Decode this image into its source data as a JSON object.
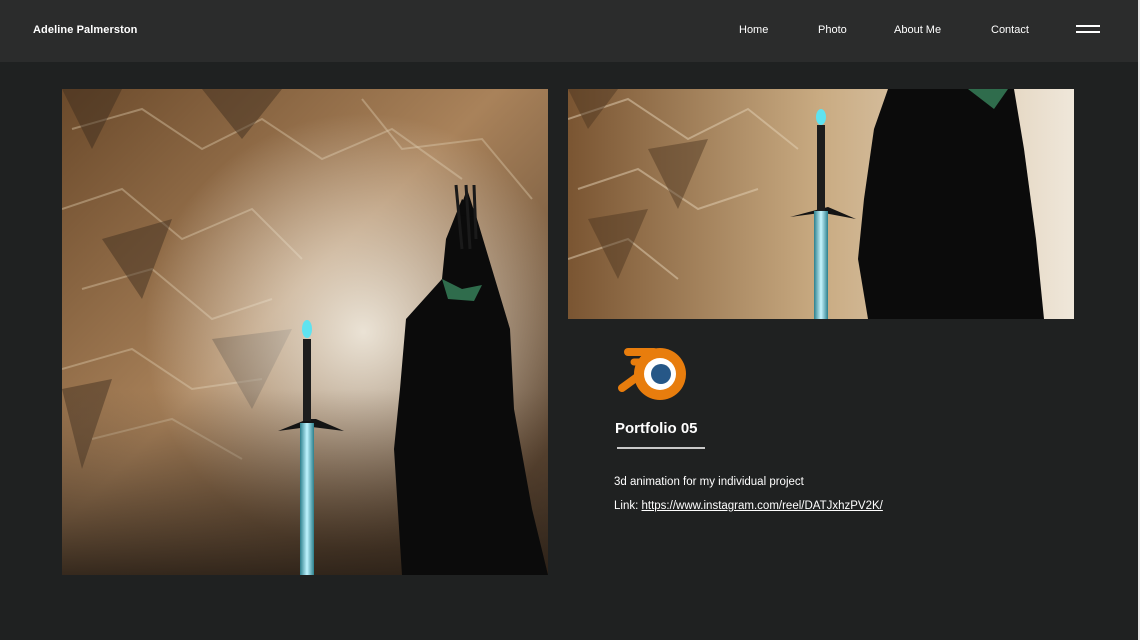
{
  "header": {
    "brand": "Adeline Palmerston",
    "nav": [
      "Home",
      "Photo",
      "About Me",
      "Contact"
    ]
  },
  "icons": {
    "menu": "hamburger-menu-icon",
    "app_logo": "blender-logo-icon"
  },
  "project": {
    "title": "Portfolio 05",
    "description": "3d animation for my individual project",
    "link_label": "Link:",
    "link_text": "https://www.instagram.com/reel/DATJxhzPV2K/"
  },
  "colors": {
    "page_background": "#1f2121",
    "header_background": "#2b2c2c",
    "text": "#ffffff",
    "logo_orange": "#e87d0d",
    "logo_blue": "#265787"
  }
}
